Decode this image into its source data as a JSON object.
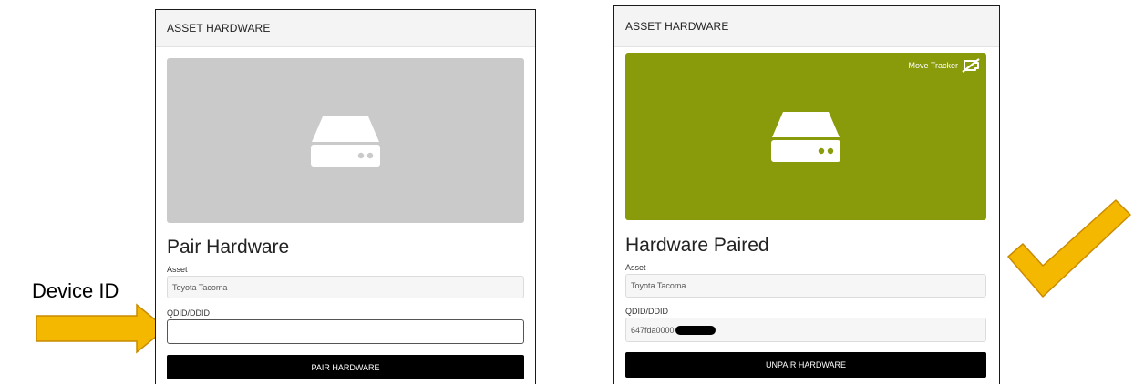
{
  "annotation": {
    "device_id_label": "Device ID"
  },
  "colors": {
    "unpaired_image_bg": "#cacaca",
    "paired_image_bg": "#899a0a",
    "button_bg": "#000000",
    "annotation_gold": "#f5b800"
  },
  "left_panel": {
    "header": "ASSET HARDWARE",
    "image_icon": "hard-drive-icon",
    "title": "Pair Hardware",
    "asset_label": "Asset",
    "asset_value": "Toyota Tacoma",
    "qdid_label": "QDID/DDID",
    "qdid_value": "",
    "button_label": "PAIR HARDWARE"
  },
  "right_panel": {
    "header": "ASSET HARDWARE",
    "image_icon": "hard-drive-icon",
    "move_tracker_label": "Move Tracker",
    "move_tracker_icon": "battery-slash-icon",
    "title": "Hardware Paired",
    "asset_label": "Asset",
    "asset_value": "Toyota Tacoma",
    "qdid_label": "QDID/DDID",
    "qdid_value": "647fda0000",
    "button_label": "UNPAIR HARDWARE"
  }
}
